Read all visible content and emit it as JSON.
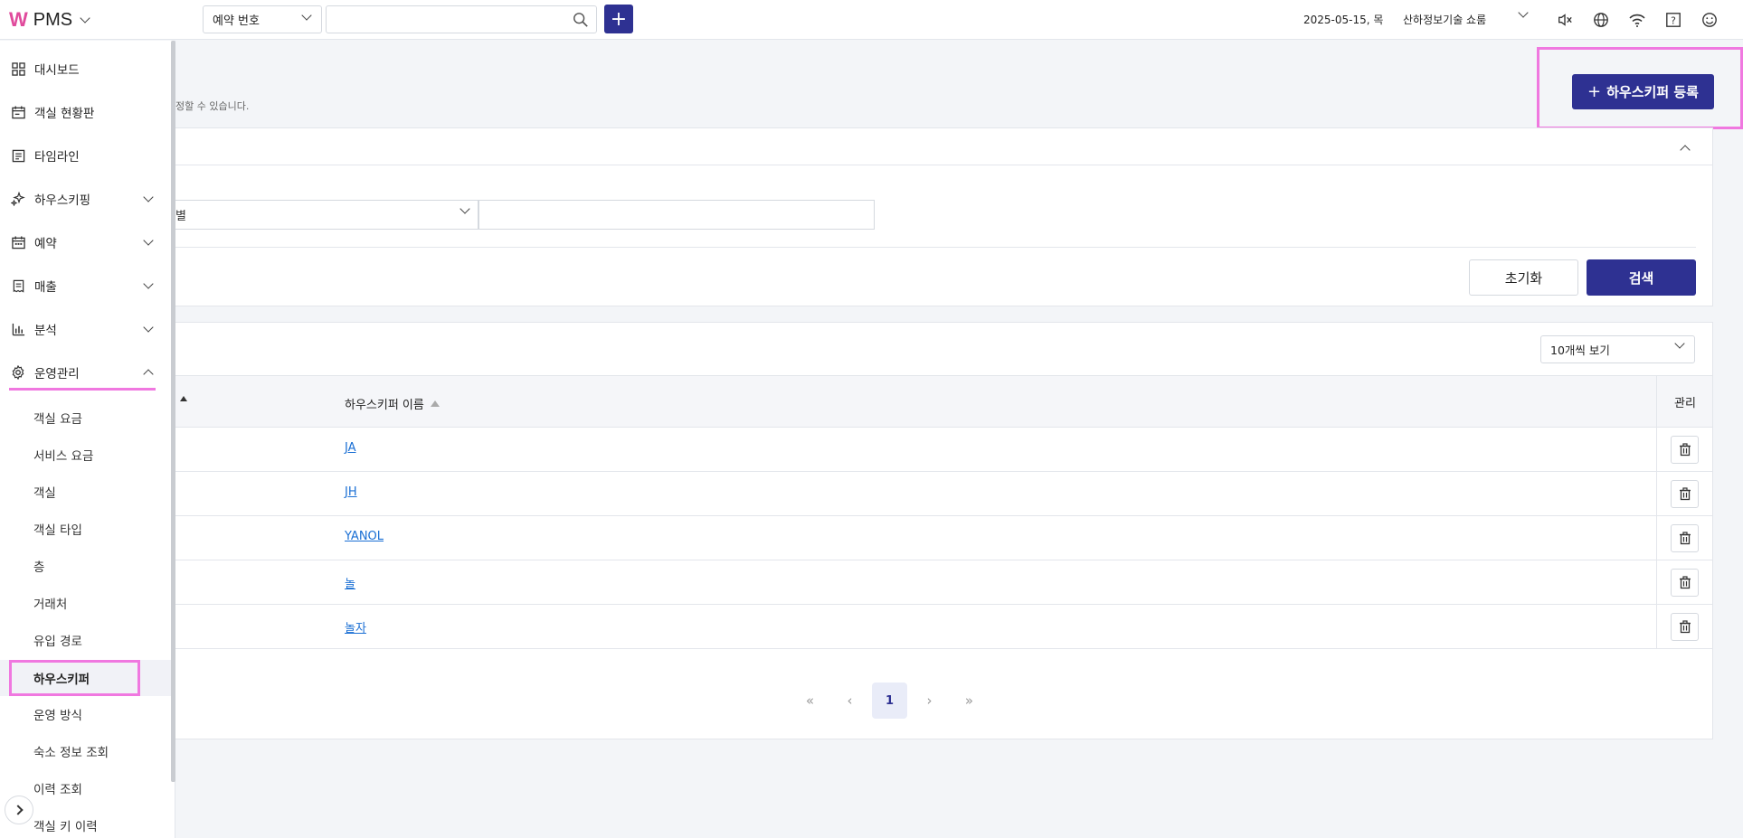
{
  "app": {
    "name": "PMS"
  },
  "topbar": {
    "search_type": "예약 번호",
    "search_placeholder": "",
    "date": "2025-05-15, 목",
    "store": "산하정보기술 쇼룸"
  },
  "sidebar": {
    "items": [
      {
        "label": "대시보드",
        "icon": "grid-icon"
      },
      {
        "label": "객실 현황판",
        "icon": "calendar-icon"
      },
      {
        "label": "타임라인",
        "icon": "note-icon"
      },
      {
        "label": "하우스키핑",
        "icon": "sparkle-icon"
      },
      {
        "label": "예약",
        "icon": "calendar-check-icon"
      },
      {
        "label": "매출",
        "icon": "receipt-icon"
      },
      {
        "label": "분석",
        "icon": "bar-chart-icon"
      },
      {
        "label": "운영관리",
        "icon": "gear-icon"
      }
    ],
    "sub_items": [
      {
        "label": "객실 요금"
      },
      {
        "label": "서비스 요금"
      },
      {
        "label": "객실"
      },
      {
        "label": "객실 타입"
      },
      {
        "label": "층"
      },
      {
        "label": "거래처"
      },
      {
        "label": "유입 경로"
      },
      {
        "label": "하우스키퍼"
      },
      {
        "label": "운영 방식"
      },
      {
        "label": "숙소 정보 조회"
      },
      {
        "label": "이력 조회"
      },
      {
        "label": "객실 키 이력"
      }
    ]
  },
  "main": {
    "description": "정할 수 있습니다.",
    "add_button": "하우스키퍼 등록",
    "filter": {
      "select_value": "별",
      "input_value": "",
      "reset_label": "초기화",
      "search_label": "검색"
    },
    "table": {
      "page_size": "10개씩 보기",
      "columns": {
        "name": "하우스키퍼 이름",
        "manage": "관리"
      },
      "rows": [
        {
          "name": "JA"
        },
        {
          "name": "JH"
        },
        {
          "name": "YANOL"
        },
        {
          "name": "놀"
        },
        {
          "name": "놀자"
        }
      ]
    },
    "pagination": {
      "current": "1"
    }
  },
  "colors": {
    "primary": "#2e3192",
    "highlight": "#f078e0",
    "link": "#1a6fd4"
  }
}
